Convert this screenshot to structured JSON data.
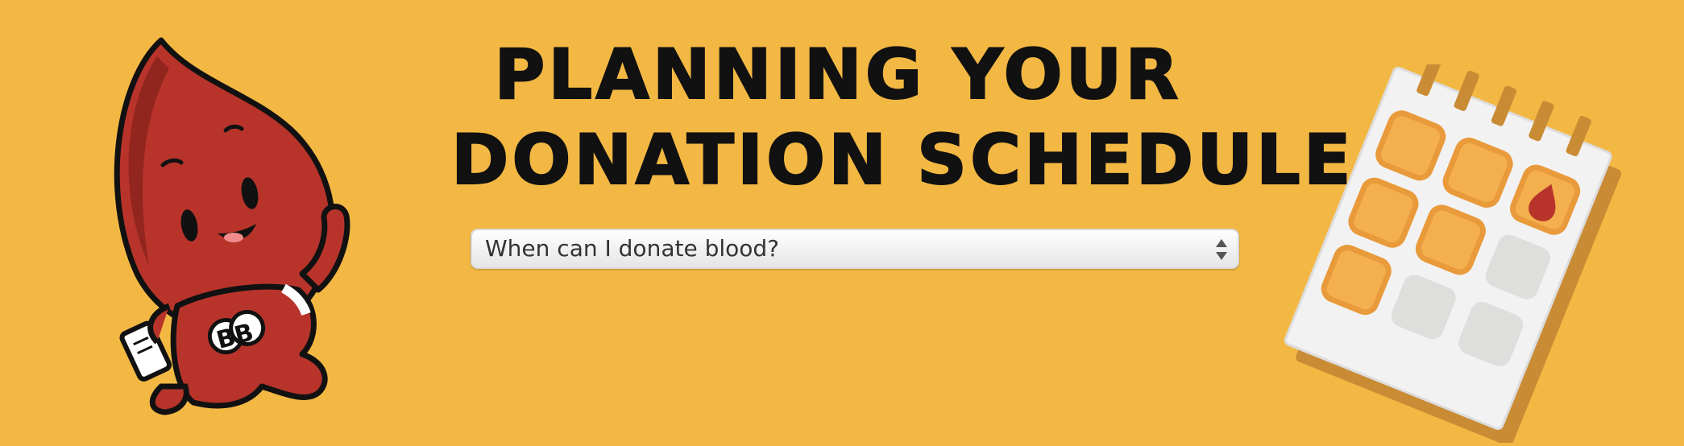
{
  "header": {
    "title_line_1": "Planning your",
    "title_line_2": "donation schedule"
  },
  "question_select": {
    "selected_value": "When can I donate blood?"
  },
  "mascot": {
    "badge_text": "BB",
    "icon": "blood-drop-mascot"
  },
  "calendar": {
    "icon": "calendar-with-blood-drop"
  },
  "colors": {
    "background": "#F3B843",
    "blood_red": "#B8342B",
    "calendar_orange": "#F4B04E"
  }
}
